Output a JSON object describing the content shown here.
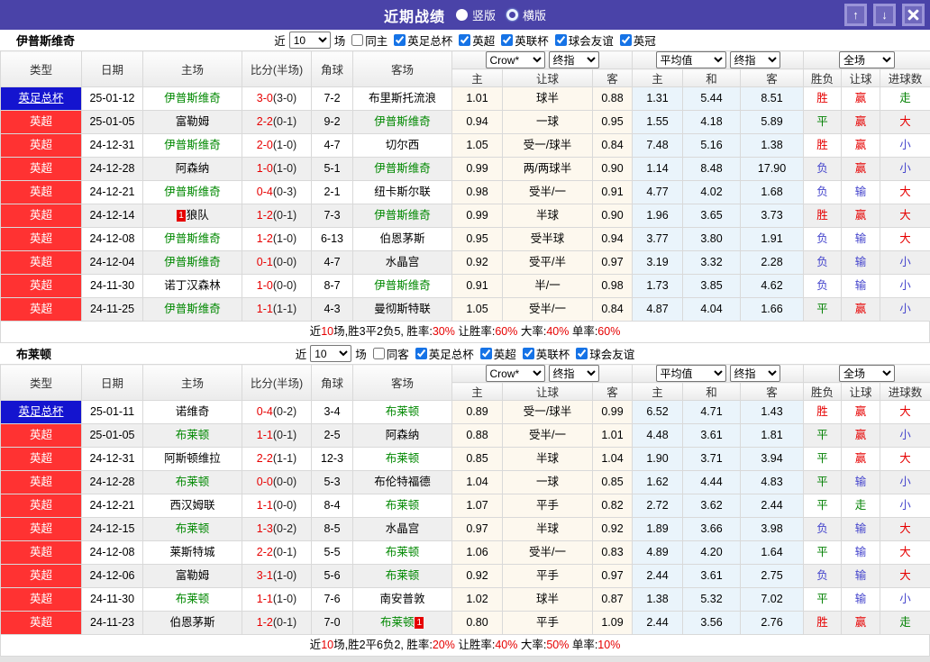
{
  "labels": {
    "near": "近",
    "games": "场"
  },
  "colors": {
    "titlebar": "#4a43a8",
    "league_cup_bg": "#1414cf",
    "league_epl_bg": "#ff3232",
    "focus_team": "#008800",
    "win_red": "#e60000",
    "draw_green": "#008000",
    "lose_blue": "#4444cc",
    "crow_col_bg": "#fdf8ee",
    "avg_col_bg": "#eaf4fb"
  },
  "titlebar": {
    "title": "近期战绩",
    "radios": [
      {
        "label": "竖版",
        "selected": true
      },
      {
        "label": "横版",
        "selected": false
      }
    ]
  },
  "table_header": {
    "left_cols": [
      "类型",
      "日期",
      "主场",
      "比分(半场)",
      "角球",
      "客场"
    ],
    "group1_selects": [
      "Crow*",
      "终指"
    ],
    "group1_sub": [
      "主",
      "让球",
      "客"
    ],
    "group2_selects": [
      "平均值",
      "终指"
    ],
    "group2_sub": [
      "主",
      "和",
      "客"
    ],
    "group3_select": "全场",
    "group3_sub": [
      "胜负",
      "让球",
      "进球数"
    ]
  },
  "sections": [
    {
      "team": "伊普斯维奇",
      "filter": {
        "count": "10",
        "same": "同主",
        "same_checked": false,
        "leagues": [
          "英足总杯",
          "英超",
          "英联杯",
          "球会友谊",
          "英冠"
        ]
      },
      "rows": [
        {
          "league": "英足总杯",
          "lt": "cup",
          "date": "25-01-12",
          "home": "伊普斯维奇",
          "hf": true,
          "hb": null,
          "ft": "3-0",
          "ht": "(3-0)",
          "corner": "7-2",
          "away": "布里斯托流浪",
          "af": false,
          "ab": null,
          "crow": [
            "1.01",
            "球半",
            "0.88"
          ],
          "avg": [
            "1.31",
            "5.44",
            "8.51"
          ],
          "res": [
            [
              "胜",
              "r"
            ],
            [
              "赢",
              "r"
            ],
            [
              "走",
              "g"
            ]
          ]
        },
        {
          "league": "英超",
          "lt": "epl",
          "date": "25-01-05",
          "home": "富勒姆",
          "hf": false,
          "hb": null,
          "ft": "2-2",
          "ht": "(0-1)",
          "corner": "9-2",
          "away": "伊普斯维奇",
          "af": true,
          "ab": null,
          "crow": [
            "0.94",
            "一球",
            "0.95"
          ],
          "avg": [
            "1.55",
            "4.18",
            "5.89"
          ],
          "res": [
            [
              "平",
              "g"
            ],
            [
              "赢",
              "r"
            ],
            [
              "大",
              "r"
            ]
          ]
        },
        {
          "league": "英超",
          "lt": "epl",
          "date": "24-12-31",
          "home": "伊普斯维奇",
          "hf": true,
          "hb": null,
          "ft": "2-0",
          "ht": "(1-0)",
          "corner": "4-7",
          "away": "切尔西",
          "af": false,
          "ab": null,
          "crow": [
            "1.05",
            "受一/球半",
            "0.84"
          ],
          "avg": [
            "7.48",
            "5.16",
            "1.38"
          ],
          "res": [
            [
              "胜",
              "r"
            ],
            [
              "赢",
              "r"
            ],
            [
              "小",
              "b"
            ]
          ]
        },
        {
          "league": "英超",
          "lt": "epl",
          "date": "24-12-28",
          "home": "阿森纳",
          "hf": false,
          "hb": null,
          "ft": "1-0",
          "ht": "(1-0)",
          "corner": "5-1",
          "away": "伊普斯维奇",
          "af": true,
          "ab": null,
          "crow": [
            "0.99",
            "两/两球半",
            "0.90"
          ],
          "avg": [
            "1.14",
            "8.48",
            "17.90"
          ],
          "res": [
            [
              "负",
              "b"
            ],
            [
              "赢",
              "r"
            ],
            [
              "小",
              "b"
            ]
          ]
        },
        {
          "league": "英超",
          "lt": "epl",
          "date": "24-12-21",
          "home": "伊普斯维奇",
          "hf": true,
          "hb": null,
          "ft": "0-4",
          "ht": "(0-3)",
          "corner": "2-1",
          "away": "纽卡斯尔联",
          "af": false,
          "ab": null,
          "crow": [
            "0.98",
            "受半/一",
            "0.91"
          ],
          "avg": [
            "4.77",
            "4.02",
            "1.68"
          ],
          "res": [
            [
              "负",
              "b"
            ],
            [
              "输",
              "b"
            ],
            [
              "大",
              "r"
            ]
          ]
        },
        {
          "league": "英超",
          "lt": "epl",
          "date": "24-12-14",
          "home": "狼队",
          "hf": false,
          "hb": [
            "1",
            "before"
          ],
          "ft": "1-2",
          "ht": "(0-1)",
          "corner": "7-3",
          "away": "伊普斯维奇",
          "af": true,
          "ab": null,
          "crow": [
            "0.99",
            "半球",
            "0.90"
          ],
          "avg": [
            "1.96",
            "3.65",
            "3.73"
          ],
          "res": [
            [
              "胜",
              "r"
            ],
            [
              "赢",
              "r"
            ],
            [
              "大",
              "r"
            ]
          ]
        },
        {
          "league": "英超",
          "lt": "epl",
          "date": "24-12-08",
          "home": "伊普斯维奇",
          "hf": true,
          "hb": null,
          "ft": "1-2",
          "ht": "(1-0)",
          "corner": "6-13",
          "away": "伯恩茅斯",
          "af": false,
          "ab": null,
          "crow": [
            "0.95",
            "受半球",
            "0.94"
          ],
          "avg": [
            "3.77",
            "3.80",
            "1.91"
          ],
          "res": [
            [
              "负",
              "b"
            ],
            [
              "输",
              "b"
            ],
            [
              "大",
              "r"
            ]
          ]
        },
        {
          "league": "英超",
          "lt": "epl",
          "date": "24-12-04",
          "home": "伊普斯维奇",
          "hf": true,
          "hb": null,
          "ft": "0-1",
          "ht": "(0-0)",
          "corner": "4-7",
          "away": "水晶宫",
          "af": false,
          "ab": null,
          "crow": [
            "0.92",
            "受平/半",
            "0.97"
          ],
          "avg": [
            "3.19",
            "3.32",
            "2.28"
          ],
          "res": [
            [
              "负",
              "b"
            ],
            [
              "输",
              "b"
            ],
            [
              "小",
              "b"
            ]
          ]
        },
        {
          "league": "英超",
          "lt": "epl",
          "date": "24-11-30",
          "home": "诺丁汉森林",
          "hf": false,
          "hb": null,
          "ft": "1-0",
          "ht": "(0-0)",
          "corner": "8-7",
          "away": "伊普斯维奇",
          "af": true,
          "ab": null,
          "crow": [
            "0.91",
            "半/一",
            "0.98"
          ],
          "avg": [
            "1.73",
            "3.85",
            "4.62"
          ],
          "res": [
            [
              "负",
              "b"
            ],
            [
              "输",
              "b"
            ],
            [
              "小",
              "b"
            ]
          ]
        },
        {
          "league": "英超",
          "lt": "epl",
          "date": "24-11-25",
          "home": "伊普斯维奇",
          "hf": true,
          "hb": null,
          "ft": "1-1",
          "ht": "(1-1)",
          "corner": "4-3",
          "away": "曼彻斯特联",
          "af": false,
          "ab": null,
          "crow": [
            "1.05",
            "受半/一",
            "0.84"
          ],
          "avg": [
            "4.87",
            "4.04",
            "1.66"
          ],
          "res": [
            [
              "平",
              "g"
            ],
            [
              "赢",
              "r"
            ],
            [
              "小",
              "b"
            ]
          ]
        }
      ],
      "summary": [
        [
          "近",
          0
        ],
        [
          "10",
          1
        ],
        [
          "场,胜3平2负5, 胜率:",
          0
        ],
        [
          "30%",
          1
        ],
        [
          " 让胜率:",
          0
        ],
        [
          "60%",
          1
        ],
        [
          " 大率:",
          0
        ],
        [
          "40%",
          1
        ],
        [
          " 单率:",
          0
        ],
        [
          "60%",
          1
        ]
      ]
    },
    {
      "team": "布莱顿",
      "filter": {
        "count": "10",
        "same": "同客",
        "same_checked": false,
        "leagues": [
          "英足总杯",
          "英超",
          "英联杯",
          "球会友谊"
        ]
      },
      "rows": [
        {
          "league": "英足总杯",
          "lt": "cup",
          "date": "25-01-11",
          "home": "诺维奇",
          "hf": false,
          "hb": null,
          "ft": "0-4",
          "ht": "(0-2)",
          "corner": "3-4",
          "away": "布莱顿",
          "af": true,
          "ab": null,
          "crow": [
            "0.89",
            "受一/球半",
            "0.99"
          ],
          "avg": [
            "6.52",
            "4.71",
            "1.43"
          ],
          "res": [
            [
              "胜",
              "r"
            ],
            [
              "赢",
              "r"
            ],
            [
              "大",
              "r"
            ]
          ]
        },
        {
          "league": "英超",
          "lt": "epl",
          "date": "25-01-05",
          "home": "布莱顿",
          "hf": true,
          "hb": null,
          "ft": "1-1",
          "ht": "(0-1)",
          "corner": "2-5",
          "away": "阿森纳",
          "af": false,
          "ab": null,
          "crow": [
            "0.88",
            "受半/一",
            "1.01"
          ],
          "avg": [
            "4.48",
            "3.61",
            "1.81"
          ],
          "res": [
            [
              "平",
              "g"
            ],
            [
              "赢",
              "r"
            ],
            [
              "小",
              "b"
            ]
          ]
        },
        {
          "league": "英超",
          "lt": "epl",
          "date": "24-12-31",
          "home": "阿斯顿维拉",
          "hf": false,
          "hb": null,
          "ft": "2-2",
          "ht": "(1-1)",
          "corner": "12-3",
          "away": "布莱顿",
          "af": true,
          "ab": null,
          "crow": [
            "0.85",
            "半球",
            "1.04"
          ],
          "avg": [
            "1.90",
            "3.71",
            "3.94"
          ],
          "res": [
            [
              "平",
              "g"
            ],
            [
              "赢",
              "r"
            ],
            [
              "大",
              "r"
            ]
          ]
        },
        {
          "league": "英超",
          "lt": "epl",
          "date": "24-12-28",
          "home": "布莱顿",
          "hf": true,
          "hb": null,
          "ft": "0-0",
          "ht": "(0-0)",
          "corner": "5-3",
          "away": "布伦特福德",
          "af": false,
          "ab": null,
          "crow": [
            "1.04",
            "一球",
            "0.85"
          ],
          "avg": [
            "1.62",
            "4.44",
            "4.83"
          ],
          "res": [
            [
              "平",
              "g"
            ],
            [
              "输",
              "b"
            ],
            [
              "小",
              "b"
            ]
          ]
        },
        {
          "league": "英超",
          "lt": "epl",
          "date": "24-12-21",
          "home": "西汉姆联",
          "hf": false,
          "hb": null,
          "ft": "1-1",
          "ht": "(0-0)",
          "corner": "8-4",
          "away": "布莱顿",
          "af": true,
          "ab": null,
          "crow": [
            "1.07",
            "平手",
            "0.82"
          ],
          "avg": [
            "2.72",
            "3.62",
            "2.44"
          ],
          "res": [
            [
              "平",
              "g"
            ],
            [
              "走",
              "g"
            ],
            [
              "小",
              "b"
            ]
          ]
        },
        {
          "league": "英超",
          "lt": "epl",
          "date": "24-12-15",
          "home": "布莱顿",
          "hf": true,
          "hb": null,
          "ft": "1-3",
          "ht": "(0-2)",
          "corner": "8-5",
          "away": "水晶宫",
          "af": false,
          "ab": null,
          "crow": [
            "0.97",
            "半球",
            "0.92"
          ],
          "avg": [
            "1.89",
            "3.66",
            "3.98"
          ],
          "res": [
            [
              "负",
              "b"
            ],
            [
              "输",
              "b"
            ],
            [
              "大",
              "r"
            ]
          ]
        },
        {
          "league": "英超",
          "lt": "epl",
          "date": "24-12-08",
          "home": "莱斯特城",
          "hf": false,
          "hb": null,
          "ft": "2-2",
          "ht": "(0-1)",
          "corner": "5-5",
          "away": "布莱顿",
          "af": true,
          "ab": null,
          "crow": [
            "1.06",
            "受半/一",
            "0.83"
          ],
          "avg": [
            "4.89",
            "4.20",
            "1.64"
          ],
          "res": [
            [
              "平",
              "g"
            ],
            [
              "输",
              "b"
            ],
            [
              "大",
              "r"
            ]
          ]
        },
        {
          "league": "英超",
          "lt": "epl",
          "date": "24-12-06",
          "home": "富勒姆",
          "hf": false,
          "hb": null,
          "ft": "3-1",
          "ht": "(1-0)",
          "corner": "5-6",
          "away": "布莱顿",
          "af": true,
          "ab": null,
          "crow": [
            "0.92",
            "平手",
            "0.97"
          ],
          "avg": [
            "2.44",
            "3.61",
            "2.75"
          ],
          "res": [
            [
              "负",
              "b"
            ],
            [
              "输",
              "b"
            ],
            [
              "大",
              "r"
            ]
          ]
        },
        {
          "league": "英超",
          "lt": "epl",
          "date": "24-11-30",
          "home": "布莱顿",
          "hf": true,
          "hb": null,
          "ft": "1-1",
          "ht": "(1-0)",
          "corner": "7-6",
          "away": "南安普敦",
          "af": false,
          "ab": null,
          "crow": [
            "1.02",
            "球半",
            "0.87"
          ],
          "avg": [
            "1.38",
            "5.32",
            "7.02"
          ],
          "res": [
            [
              "平",
              "g"
            ],
            [
              "输",
              "b"
            ],
            [
              "小",
              "b"
            ]
          ]
        },
        {
          "league": "英超",
          "lt": "epl",
          "date": "24-11-23",
          "home": "伯恩茅斯",
          "hf": false,
          "hb": null,
          "ft": "1-2",
          "ht": "(0-1)",
          "corner": "7-0",
          "away": "布莱顿",
          "af": true,
          "ab": [
            "1",
            "after"
          ],
          "crow": [
            "0.80",
            "平手",
            "1.09"
          ],
          "avg": [
            "2.44",
            "3.56",
            "2.76"
          ],
          "res": [
            [
              "胜",
              "r"
            ],
            [
              "赢",
              "r"
            ],
            [
              "走",
              "g"
            ]
          ]
        }
      ],
      "summary": [
        [
          "近",
          0
        ],
        [
          "10",
          1
        ],
        [
          "场,胜2平6负2, 胜率:",
          0
        ],
        [
          "20%",
          1
        ],
        [
          " 让胜率:",
          0
        ],
        [
          "40%",
          1
        ],
        [
          " 大率:",
          0
        ],
        [
          "50%",
          1
        ],
        [
          " 单率:",
          0
        ],
        [
          "10%",
          1
        ]
      ]
    }
  ]
}
